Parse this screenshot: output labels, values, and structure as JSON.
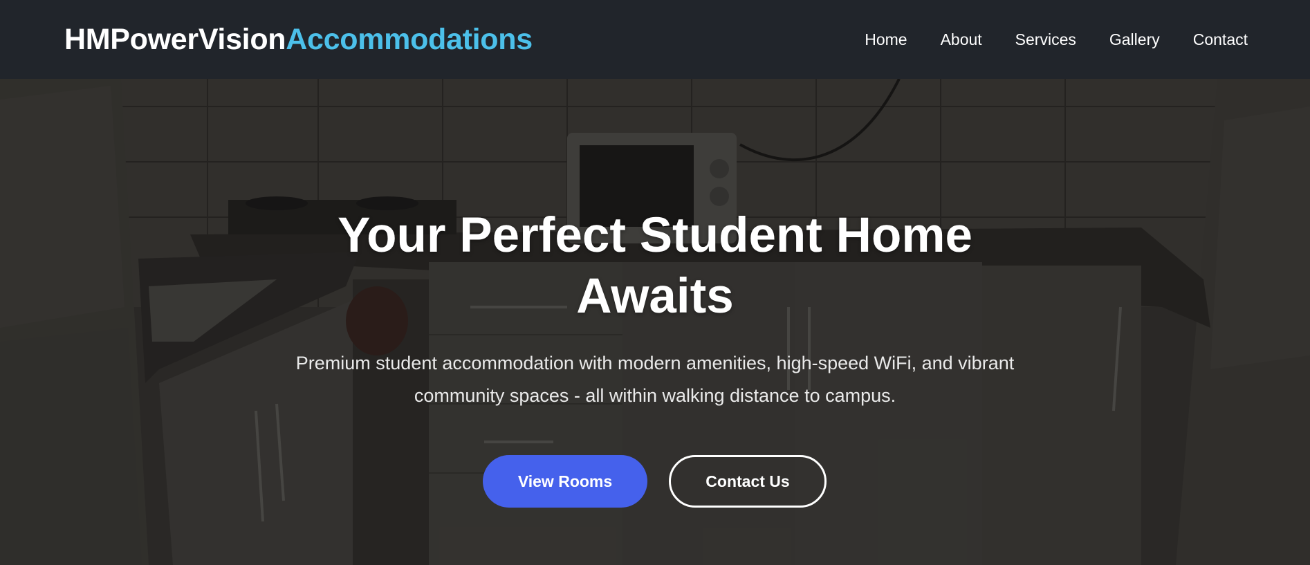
{
  "brand": {
    "part1": "HMPowerVision",
    "part2": "Accommodations"
  },
  "nav": {
    "items": [
      "Home",
      "About",
      "Services",
      "Gallery",
      "Contact"
    ]
  },
  "hero": {
    "title": "Your Perfect Student Home Awaits",
    "subtitle": "Premium student accommodation with modern amenities, high-speed WiFi, and vibrant community spaces - all within walking distance to campus.",
    "primary_button": "View Rooms",
    "secondary_button": "Contact Us",
    "background_image": "kitchen-photo"
  },
  "colors": {
    "navbar_bg": "#21252b",
    "brand_accent": "#4cc0ea",
    "primary_button": "#4561ec",
    "text": "#ffffff"
  }
}
